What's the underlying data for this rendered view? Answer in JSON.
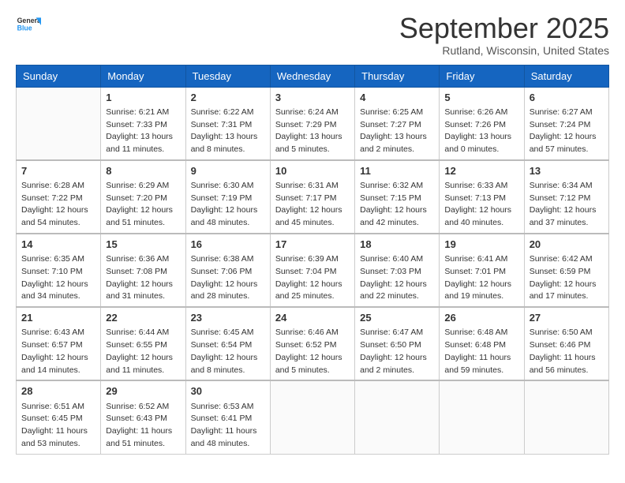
{
  "header": {
    "logo_general": "General",
    "logo_blue": "Blue",
    "month_title": "September 2025",
    "location": "Rutland, Wisconsin, United States"
  },
  "days_of_week": [
    "Sunday",
    "Monday",
    "Tuesday",
    "Wednesday",
    "Thursday",
    "Friday",
    "Saturday"
  ],
  "weeks": [
    [
      {
        "day": "",
        "sunrise": "",
        "sunset": "",
        "daylight": ""
      },
      {
        "day": "1",
        "sunrise": "Sunrise: 6:21 AM",
        "sunset": "Sunset: 7:33 PM",
        "daylight": "Daylight: 13 hours and 11 minutes."
      },
      {
        "day": "2",
        "sunrise": "Sunrise: 6:22 AM",
        "sunset": "Sunset: 7:31 PM",
        "daylight": "Daylight: 13 hours and 8 minutes."
      },
      {
        "day": "3",
        "sunrise": "Sunrise: 6:24 AM",
        "sunset": "Sunset: 7:29 PM",
        "daylight": "Daylight: 13 hours and 5 minutes."
      },
      {
        "day": "4",
        "sunrise": "Sunrise: 6:25 AM",
        "sunset": "Sunset: 7:27 PM",
        "daylight": "Daylight: 13 hours and 2 minutes."
      },
      {
        "day": "5",
        "sunrise": "Sunrise: 6:26 AM",
        "sunset": "Sunset: 7:26 PM",
        "daylight": "Daylight: 13 hours and 0 minutes."
      },
      {
        "day": "6",
        "sunrise": "Sunrise: 6:27 AM",
        "sunset": "Sunset: 7:24 PM",
        "daylight": "Daylight: 12 hours and 57 minutes."
      }
    ],
    [
      {
        "day": "7",
        "sunrise": "Sunrise: 6:28 AM",
        "sunset": "Sunset: 7:22 PM",
        "daylight": "Daylight: 12 hours and 54 minutes."
      },
      {
        "day": "8",
        "sunrise": "Sunrise: 6:29 AM",
        "sunset": "Sunset: 7:20 PM",
        "daylight": "Daylight: 12 hours and 51 minutes."
      },
      {
        "day": "9",
        "sunrise": "Sunrise: 6:30 AM",
        "sunset": "Sunset: 7:19 PM",
        "daylight": "Daylight: 12 hours and 48 minutes."
      },
      {
        "day": "10",
        "sunrise": "Sunrise: 6:31 AM",
        "sunset": "Sunset: 7:17 PM",
        "daylight": "Daylight: 12 hours and 45 minutes."
      },
      {
        "day": "11",
        "sunrise": "Sunrise: 6:32 AM",
        "sunset": "Sunset: 7:15 PM",
        "daylight": "Daylight: 12 hours and 42 minutes."
      },
      {
        "day": "12",
        "sunrise": "Sunrise: 6:33 AM",
        "sunset": "Sunset: 7:13 PM",
        "daylight": "Daylight: 12 hours and 40 minutes."
      },
      {
        "day": "13",
        "sunrise": "Sunrise: 6:34 AM",
        "sunset": "Sunset: 7:12 PM",
        "daylight": "Daylight: 12 hours and 37 minutes."
      }
    ],
    [
      {
        "day": "14",
        "sunrise": "Sunrise: 6:35 AM",
        "sunset": "Sunset: 7:10 PM",
        "daylight": "Daylight: 12 hours and 34 minutes."
      },
      {
        "day": "15",
        "sunrise": "Sunrise: 6:36 AM",
        "sunset": "Sunset: 7:08 PM",
        "daylight": "Daylight: 12 hours and 31 minutes."
      },
      {
        "day": "16",
        "sunrise": "Sunrise: 6:38 AM",
        "sunset": "Sunset: 7:06 PM",
        "daylight": "Daylight: 12 hours and 28 minutes."
      },
      {
        "day": "17",
        "sunrise": "Sunrise: 6:39 AM",
        "sunset": "Sunset: 7:04 PM",
        "daylight": "Daylight: 12 hours and 25 minutes."
      },
      {
        "day": "18",
        "sunrise": "Sunrise: 6:40 AM",
        "sunset": "Sunset: 7:03 PM",
        "daylight": "Daylight: 12 hours and 22 minutes."
      },
      {
        "day": "19",
        "sunrise": "Sunrise: 6:41 AM",
        "sunset": "Sunset: 7:01 PM",
        "daylight": "Daylight: 12 hours and 19 minutes."
      },
      {
        "day": "20",
        "sunrise": "Sunrise: 6:42 AM",
        "sunset": "Sunset: 6:59 PM",
        "daylight": "Daylight: 12 hours and 17 minutes."
      }
    ],
    [
      {
        "day": "21",
        "sunrise": "Sunrise: 6:43 AM",
        "sunset": "Sunset: 6:57 PM",
        "daylight": "Daylight: 12 hours and 14 minutes."
      },
      {
        "day": "22",
        "sunrise": "Sunrise: 6:44 AM",
        "sunset": "Sunset: 6:55 PM",
        "daylight": "Daylight: 12 hours and 11 minutes."
      },
      {
        "day": "23",
        "sunrise": "Sunrise: 6:45 AM",
        "sunset": "Sunset: 6:54 PM",
        "daylight": "Daylight: 12 hours and 8 minutes."
      },
      {
        "day": "24",
        "sunrise": "Sunrise: 6:46 AM",
        "sunset": "Sunset: 6:52 PM",
        "daylight": "Daylight: 12 hours and 5 minutes."
      },
      {
        "day": "25",
        "sunrise": "Sunrise: 6:47 AM",
        "sunset": "Sunset: 6:50 PM",
        "daylight": "Daylight: 12 hours and 2 minutes."
      },
      {
        "day": "26",
        "sunrise": "Sunrise: 6:48 AM",
        "sunset": "Sunset: 6:48 PM",
        "daylight": "Daylight: 11 hours and 59 minutes."
      },
      {
        "day": "27",
        "sunrise": "Sunrise: 6:50 AM",
        "sunset": "Sunset: 6:46 PM",
        "daylight": "Daylight: 11 hours and 56 minutes."
      }
    ],
    [
      {
        "day": "28",
        "sunrise": "Sunrise: 6:51 AM",
        "sunset": "Sunset: 6:45 PM",
        "daylight": "Daylight: 11 hours and 53 minutes."
      },
      {
        "day": "29",
        "sunrise": "Sunrise: 6:52 AM",
        "sunset": "Sunset: 6:43 PM",
        "daylight": "Daylight: 11 hours and 51 minutes."
      },
      {
        "day": "30",
        "sunrise": "Sunrise: 6:53 AM",
        "sunset": "Sunset: 6:41 PM",
        "daylight": "Daylight: 11 hours and 48 minutes."
      },
      {
        "day": "",
        "sunrise": "",
        "sunset": "",
        "daylight": ""
      },
      {
        "day": "",
        "sunrise": "",
        "sunset": "",
        "daylight": ""
      },
      {
        "day": "",
        "sunrise": "",
        "sunset": "",
        "daylight": ""
      },
      {
        "day": "",
        "sunrise": "",
        "sunset": "",
        "daylight": ""
      }
    ]
  ]
}
